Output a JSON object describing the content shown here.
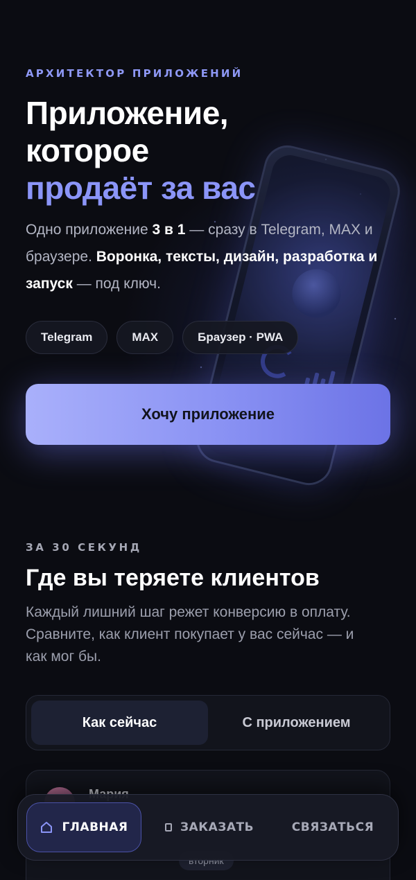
{
  "hero": {
    "eyebrow": "АРХИТЕКТОР ПРИЛОЖЕНИЙ",
    "title_line1": "Приложение,",
    "title_line2": "которое",
    "title_accent": "продаёт за вас",
    "desc_part1": "Одно приложение ",
    "desc_bold1": "3 в 1",
    "desc_part2": " — сразу в Telegram, MAX и браузере. ",
    "desc_bold2": "Воронка, тексты, дизайн, разработка и запуск",
    "desc_part3": " — под ключ.",
    "chips": [
      "Telegram",
      "MAX",
      "Браузер · PWA"
    ],
    "cta_label": "Хочу приложение"
  },
  "section": {
    "eyebrow": "ЗА 30 СЕКУНД",
    "title": "Где вы теряете клиентов",
    "desc": "Каждый лишний шаг режет конверсию в оплату. Сравните, как клиент покупает у вас сейчас — и как мог бы."
  },
  "toggle": {
    "options": [
      "Как сейчас",
      "С приложением"
    ],
    "active": "Как сейчас"
  },
  "chat": {
    "name": "Мария",
    "day": "вторник"
  },
  "nav": {
    "items": [
      "ГЛАВНАЯ",
      "ЗАКАЗАТЬ",
      "СВЯЗАТЬСЯ"
    ],
    "active": "ГЛАВНАЯ"
  },
  "colors": {
    "accent": "#8b95f8",
    "background": "#0b0c12",
    "cta_gradient_start": "#a9b0fb",
    "cta_gradient_end": "#6c73e6"
  }
}
